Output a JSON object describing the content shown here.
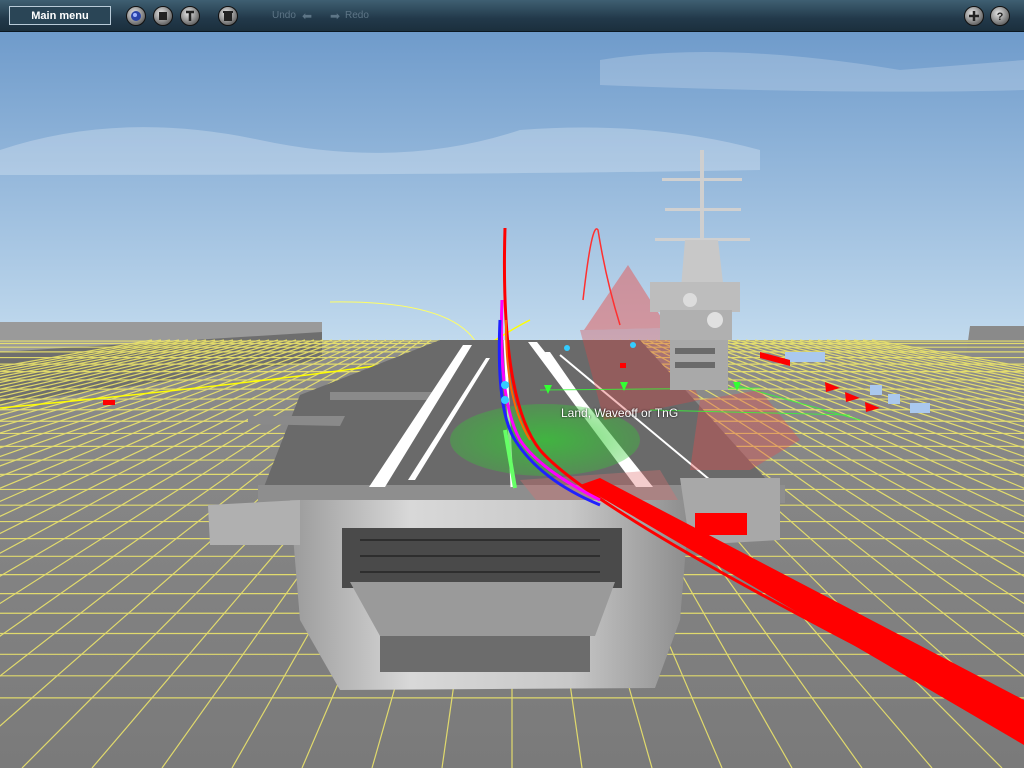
{
  "toolbar": {
    "main_menu_label": "Main menu",
    "undo_label": "Undo",
    "redo_label": "Redo",
    "buttons_left": [
      {
        "name": "view-mode-button",
        "icon": "globe-icon"
      },
      {
        "name": "stop-button",
        "icon": "stop-icon"
      },
      {
        "name": "tools-button",
        "icon": "wrench-icon"
      },
      {
        "name": "delete-button",
        "icon": "trash-icon"
      }
    ],
    "buttons_right": [
      {
        "name": "add-button",
        "icon": "plus-icon"
      },
      {
        "name": "help-button",
        "icon": "question-icon"
      }
    ]
  },
  "scene": {
    "overlay_label": "Land, Waveoff or TnG",
    "colors": {
      "sky_top": "#6f9bcb",
      "sky_bottom": "#bcd6ec",
      "ground": "#808080",
      "grid": "#f2ea6a",
      "path_red": "#ff0000",
      "path_blue": "#2020ff",
      "path_magenta": "#ff00ff",
      "zone_green": "#33cc33",
      "zone_red": "#e06060"
    }
  }
}
